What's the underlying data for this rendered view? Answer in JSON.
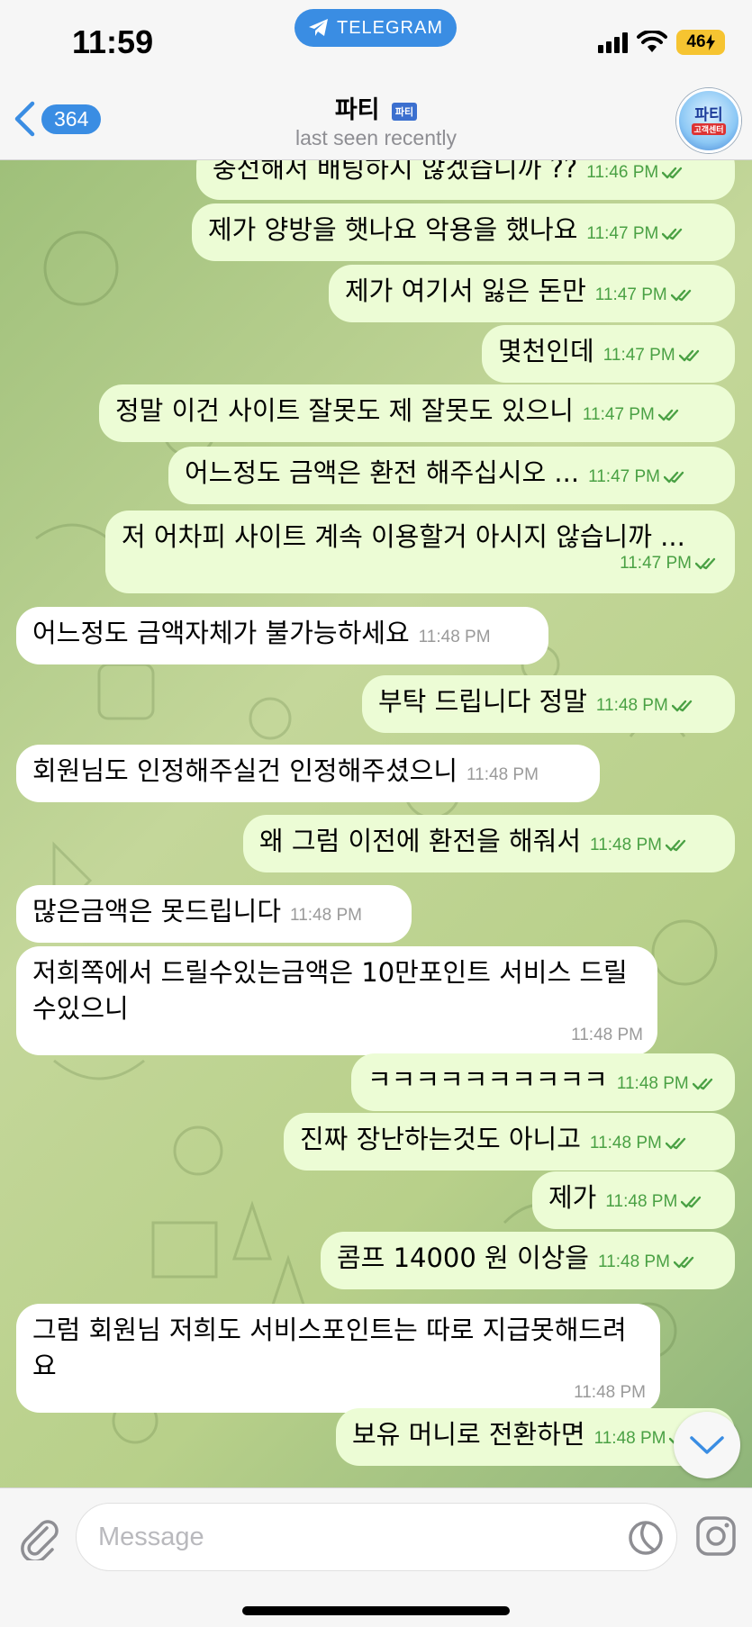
{
  "status_bar": {
    "time": "11:59",
    "app_pill": "TELEGRAM",
    "battery": "46"
  },
  "header": {
    "back_count": "364",
    "title": "파티",
    "title_tag": "파티",
    "subtitle": "last seen recently",
    "avatar_line1": "파티",
    "avatar_line2": "고객센터"
  },
  "messages": [
    {
      "dir": "out",
      "text": "충전해서 배팅하지 않겠습니까 ??",
      "time": "11:46 PM"
    },
    {
      "dir": "out",
      "text": "제가 양방을 햇나요 악용을 했나요",
      "time": "11:47 PM"
    },
    {
      "dir": "out",
      "text": "제가 여기서 잃은 돈만",
      "time": "11:47 PM"
    },
    {
      "dir": "out",
      "text": "몇천인데",
      "time": "11:47 PM"
    },
    {
      "dir": "out",
      "text": "정말 이건 사이트 잘못도 제 잘못도 있으니",
      "time": "11:47 PM"
    },
    {
      "dir": "out",
      "text": "어느정도 금액은 환전 해주십시오 ...",
      "time": "11:47 PM"
    },
    {
      "dir": "out",
      "text": "저 어차피 사이트 계속 이용할거 아시지 않습니까 ...",
      "time": "11:47 PM"
    },
    {
      "dir": "in",
      "text": "어느정도 금액자체가 불가능하세요",
      "time": "11:48 PM"
    },
    {
      "dir": "out",
      "text": "부탁 드립니다 정말",
      "time": "11:48 PM"
    },
    {
      "dir": "in",
      "text": "회원님도 인정해주실건 인정해주셨으니",
      "time": "11:48 PM"
    },
    {
      "dir": "out",
      "text": "왜 그럼 이전에 환전을 해줘서",
      "time": "11:48 PM"
    },
    {
      "dir": "in",
      "text": "많은금액은 못드립니다",
      "time": "11:48 PM"
    },
    {
      "dir": "in",
      "text": "저희쪽에서 드릴수있는금액은 10만포인트 서비스 드릴수있으니",
      "time": "11:48 PM"
    },
    {
      "dir": "out",
      "text": "ㅋㅋㅋㅋㅋㅋㅋㅋㅋㅋ",
      "time": "11:48 PM"
    },
    {
      "dir": "out",
      "text": "진짜 장난하는것도 아니고",
      "time": "11:48 PM"
    },
    {
      "dir": "out",
      "text": "제가",
      "time": "11:48 PM"
    },
    {
      "dir": "out",
      "text": "콤프 14000 원 이상을",
      "time": "11:48 PM"
    },
    {
      "dir": "in",
      "text": "그럼 회원님 저희도 서비스포인트는 따로 지급못해드려요",
      "time": "11:48 PM"
    },
    {
      "dir": "out",
      "text": "보유 머니로 전환하면",
      "time": "11:48 PM"
    }
  ],
  "input": {
    "placeholder": "Message"
  },
  "colors": {
    "accent": "#3a8de3",
    "outgoing_bubble": "#ecfcd5",
    "incoming_bubble": "#ffffff",
    "read_check": "#4aa144"
  },
  "icons": {
    "attach": "paperclip-icon",
    "sticker": "sticker-icon",
    "camera": "instagram-camera-icon",
    "scroll": "chevron-down-icon"
  }
}
